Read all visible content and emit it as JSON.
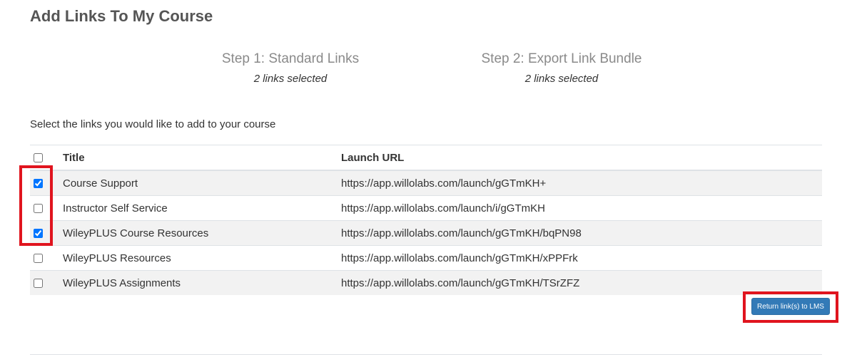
{
  "page": {
    "title": "Add Links To My Course"
  },
  "steps": [
    {
      "label": "Step 1: Standard Links",
      "count": "2 links selected"
    },
    {
      "label": "Step 2: Export Link Bundle",
      "count": "2 links selected"
    }
  ],
  "instructions": "Select the links you would like to add to your course",
  "table": {
    "headers": {
      "title": "Title",
      "url": "Launch URL"
    },
    "select_all_checked": false,
    "rows": [
      {
        "title": "Course Support",
        "url": "https://app.willolabs.com/launch/gGTmKH+",
        "checked": true
      },
      {
        "title": "Instructor Self Service",
        "url": "https://app.willolabs.com/launch/i/gGTmKH",
        "checked": false
      },
      {
        "title": "WileyPLUS Course Resources",
        "url": "https://app.willolabs.com/launch/gGTmKH/bqPN98",
        "checked": true
      },
      {
        "title": "WileyPLUS Resources",
        "url": "https://app.willolabs.com/launch/gGTmKH/xPPFrk",
        "checked": false
      },
      {
        "title": "WileyPLUS Assignments",
        "url": "https://app.willolabs.com/launch/gGTmKH/TSrZFZ",
        "checked": false
      }
    ]
  },
  "actions": {
    "return_label": "Return link(s) to LMS"
  },
  "colors": {
    "highlight": "#e0141e",
    "primary_button": "#337ab7",
    "row_stripe": "#f2f2f2"
  }
}
